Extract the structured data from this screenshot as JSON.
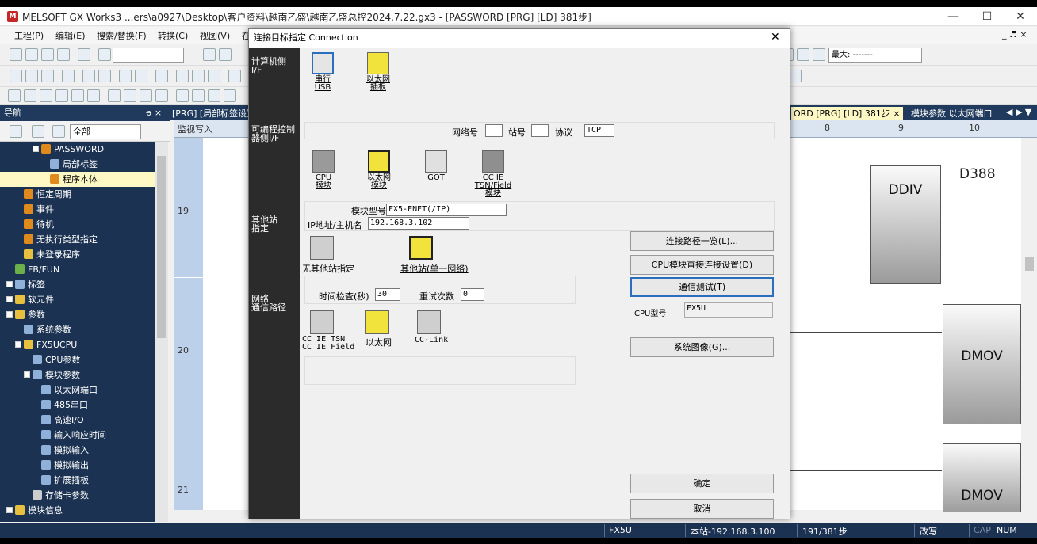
{
  "window": {
    "title": "MELSOFT GX Works3 ...ers\\a0927\\Desktop\\客户资料\\越南乙盛\\越南乙盛总控2024.7.22.gx3 - [PASSWORD [PRG] [LD] 381步]",
    "minimize": "—",
    "maximize": "☐",
    "close": "✕"
  },
  "menu": [
    "工程(P)",
    "编辑(E)",
    "搜索/替换(F)",
    "转换(C)",
    "视图(V)",
    "在"
  ],
  "menu_right": "_ ♬ ×",
  "toolbar": {
    "zoom_label": "最大: -------"
  },
  "nav": {
    "title": "导航",
    "pin": "ᵽ ×",
    "filter": "全部",
    "tree": [
      {
        "label": "PASSWORD",
        "indent": 3,
        "icon": "#e08a1e",
        "expander": true
      },
      {
        "label": "局部标签",
        "indent": 5,
        "icon": "#8fb0d8"
      },
      {
        "label": "程序本体",
        "indent": 5,
        "icon": "#e08a1e",
        "selected": true
      },
      {
        "label": "恒定周期",
        "indent": 2,
        "icon": "#e08a1e"
      },
      {
        "label": "事件",
        "indent": 2,
        "icon": "#e08a1e"
      },
      {
        "label": "待机",
        "indent": 2,
        "icon": "#e08a1e"
      },
      {
        "label": "无执行类型指定",
        "indent": 2,
        "icon": "#e08a1e"
      },
      {
        "label": "未登录程序",
        "indent": 2,
        "icon": "#e8c040"
      },
      {
        "label": "FB/FUN",
        "indent": 1,
        "icon": "#6cb04a"
      },
      {
        "label": "标签",
        "indent": 0,
        "icon": "#8fb0d8",
        "expander": true
      },
      {
        "label": "软元件",
        "indent": 0,
        "icon": "#e8c040",
        "expander": true
      },
      {
        "label": "参数",
        "indent": 0,
        "icon": "#e8c040",
        "expander": true
      },
      {
        "label": "系统参数",
        "indent": 2,
        "icon": "#8fb0d8"
      },
      {
        "label": "FX5UCPU",
        "indent": 1,
        "icon": "#e8c040",
        "expander": true
      },
      {
        "label": "CPU参数",
        "indent": 3,
        "icon": "#8fb0d8"
      },
      {
        "label": "模块参数",
        "indent": 2,
        "icon": "#8fb0d8",
        "expander": true
      },
      {
        "label": "以太网端口",
        "indent": 4,
        "icon": "#8fb0d8"
      },
      {
        "label": "485串口",
        "indent": 4,
        "icon": "#8fb0d8"
      },
      {
        "label": "高速I/O",
        "indent": 4,
        "icon": "#8fb0d8"
      },
      {
        "label": "输入响应时间",
        "indent": 4,
        "icon": "#8fb0d8"
      },
      {
        "label": "模拟输入",
        "indent": 4,
        "icon": "#8fb0d8"
      },
      {
        "label": "模拟输出",
        "indent": 4,
        "icon": "#8fb0d8"
      },
      {
        "label": "扩展插板",
        "indent": 4,
        "icon": "#8fb0d8"
      },
      {
        "label": "存储卡参数",
        "indent": 3,
        "icon": "#cccccc"
      },
      {
        "label": "模块信息",
        "indent": 0,
        "icon": "#e8c040",
        "expander": true
      }
    ]
  },
  "tabs": {
    "left": "[PRG] [局部标签设置",
    "right": "ORD [PRG] [LD] 381步 ×",
    "right2": "模块参数 以太网端口",
    "arrows": "◀ ▶ ▼"
  },
  "ladder": {
    "mode": "监视写入",
    "columns": [
      "8",
      "9",
      "10"
    ],
    "rungs": [
      "19",
      "20",
      "21"
    ],
    "blocks": {
      "ddiv": "DDIV",
      "d388": "D388",
      "dmov1": "DMOV",
      "dmov2": "DMOV"
    }
  },
  "status": {
    "cpu": "FX5U",
    "station": "本站-192.168.3.100",
    "steps": "191/381步",
    "mode": "改写",
    "cap": "CAP",
    "num": "NUM"
  },
  "dialog": {
    "title": "连接目标指定 Connection",
    "close": "✕",
    "sections": {
      "pc_if": "计算机侧\nI/F",
      "plc_if": "可编程控制\n器侧I/F",
      "other_station": "其他站\n指定",
      "route": "网络\n通信路径"
    },
    "pc_if_options": [
      "串行\nUSB",
      "以太网\n插板"
    ],
    "network_no_label": "网络号",
    "network_no": "",
    "station_no_label": "站号",
    "station_no": "",
    "protocol_label": "协议",
    "protocol": "TCP",
    "plc_if_options": [
      "CPU\n模块",
      "以太网\n模块",
      "GOT",
      "CC IE\nTSN/Field\n模块"
    ],
    "module_model_label": "模块型号",
    "module_model": "FX5-ENET(/IP)",
    "ip_label": "IP地址/主机名",
    "ip": "192.168.3.102",
    "other_options": [
      "无其他站指定",
      "其他站(单一网络)"
    ],
    "timeout_label": "时间检查(秒)",
    "timeout": "30",
    "retry_label": "重试次数",
    "retry": "0",
    "route_options": [
      "CC IE TSN\nCC IE Field",
      "以太网",
      "CC-Link"
    ],
    "buttons": {
      "route_list": "连接路径一览(L)...",
      "direct": "CPU模块直接连接设置(D)",
      "test": "通信测试(T)",
      "system_image": "系统图像(G)...",
      "ok": "确定",
      "cancel": "取消"
    },
    "cpu_model_label": "CPU型号",
    "cpu_model": "FX5U"
  }
}
